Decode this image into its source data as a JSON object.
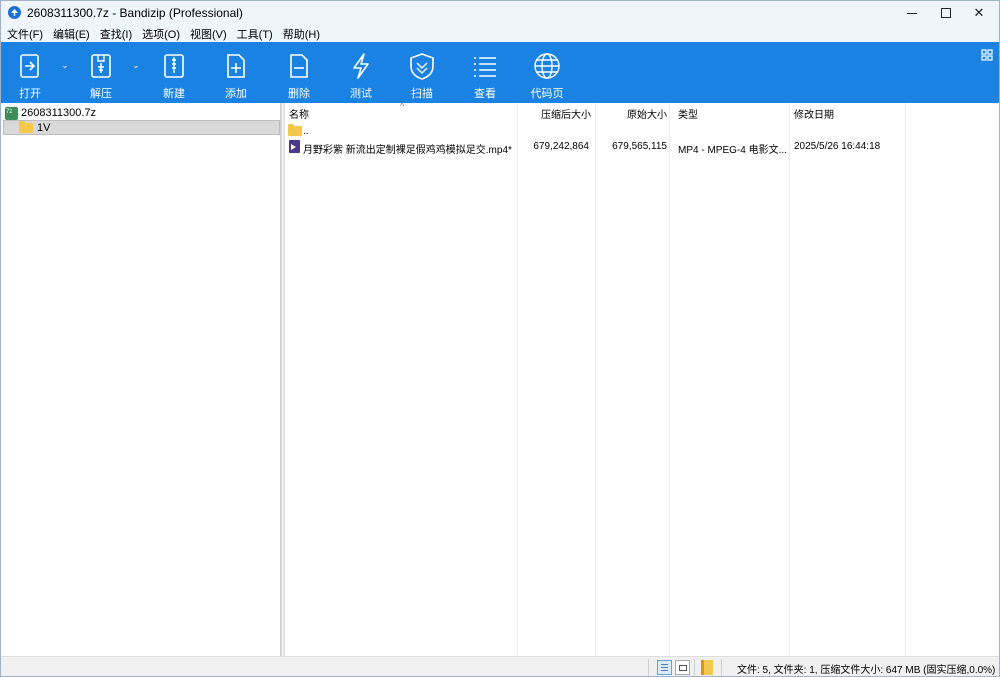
{
  "window": {
    "title": "2608311300.7z - Bandizip (Professional)"
  },
  "menu": [
    "文件(F)",
    "编辑(E)",
    "查找(I)",
    "选项(O)",
    "视图(V)",
    "工具(T)",
    "帮助(H)"
  ],
  "toolbar": {
    "items": [
      {
        "label": "打开",
        "icon": "open-icon",
        "has_dropdown": true
      },
      {
        "label": "解压",
        "icon": "extract-icon",
        "has_dropdown": true
      },
      {
        "label": "新建",
        "icon": "new-archive-icon",
        "has_dropdown": false
      },
      {
        "label": "添加",
        "icon": "add-icon",
        "has_dropdown": false
      },
      {
        "label": "删除",
        "icon": "delete-icon",
        "has_dropdown": false
      },
      {
        "label": "测试",
        "icon": "test-icon",
        "has_dropdown": false
      },
      {
        "label": "扫描",
        "icon": "scan-icon",
        "has_dropdown": false
      },
      {
        "label": "查看",
        "icon": "view-icon",
        "has_dropdown": false
      },
      {
        "label": "代码页",
        "icon": "codepage-icon",
        "has_dropdown": false
      }
    ],
    "dropdown_glyph": "⌄"
  },
  "tree": {
    "root": "2608311300.7z",
    "child": "1V"
  },
  "table": {
    "columns": [
      "名称",
      "压缩后大小",
      "原始大小",
      "类型",
      "修改日期"
    ],
    "sort_indicator": "^",
    "rows": [
      {
        "name": "..",
        "packed": "",
        "size": "",
        "type": "",
        "date": "",
        "kind": "folder"
      },
      {
        "name": "月野彩紫 新流出定制裸足假鸡鸡模拟足交.mp4*",
        "packed": "679,242,864",
        "size": "679,565,115",
        "type": "MP4 - MPEG-4 电影文...",
        "date": "2025/5/26 16:44:18",
        "kind": "mp4"
      }
    ]
  },
  "status": {
    "text": "文件: 5, 文件夹: 1, 压缩文件大小: 647 MB (固实压缩,0.0%)"
  },
  "colors": {
    "toolbar": "#1a82e2",
    "titlebar": "#eef5fb",
    "selection": "#d9d9d9"
  }
}
